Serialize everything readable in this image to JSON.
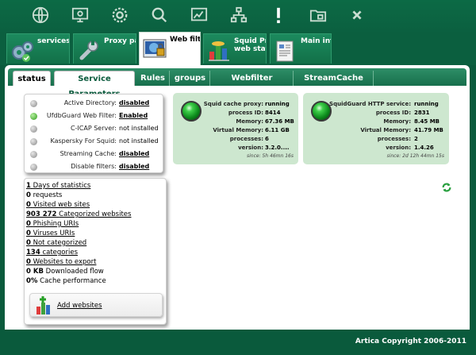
{
  "topbar": {
    "icons": [
      "globe-icon",
      "monitor-icon",
      "gear-icon",
      "search-icon",
      "chart-icon",
      "network-icon",
      "alert-icon",
      "folder-icon",
      "close-icon"
    ]
  },
  "module_tabs": [
    {
      "label": "services s",
      "icon": "gears-icon"
    },
    {
      "label": "Proxy para",
      "icon": "wrench-icon"
    },
    {
      "label": "Web filterin",
      "icon": "webfilter-icon",
      "active": true
    },
    {
      "label": "Squid Prox\nweb statis",
      "icon": "stats-icon"
    },
    {
      "label": "Main interf",
      "icon": "document-icon"
    }
  ],
  "sub_tabs": [
    {
      "label": "status",
      "active": true
    },
    {
      "label": "Service Parameters",
      "selected": true
    },
    {
      "label": "Rules"
    },
    {
      "label": "groups"
    },
    {
      "label": "Webfilter databases"
    },
    {
      "label": "StreamCache status"
    }
  ],
  "status_box": {
    "rows": [
      {
        "label": "Active Directory:",
        "value": "disabled",
        "ok": false,
        "link": true
      },
      {
        "label": "UfdbGuard Web Filter:",
        "value": "Enabled",
        "ok": true,
        "link": true
      },
      {
        "label": "C-ICAP Server:",
        "value": "not installed",
        "ok": false,
        "link": false
      },
      {
        "label": "Kaspersky For Squid:",
        "value": "not installed",
        "ok": false,
        "link": false
      },
      {
        "label": "Streaming Cache:",
        "value": "disabled",
        "ok": false,
        "link": true
      },
      {
        "label": "Disable filters:",
        "value": "disabled",
        "ok": false,
        "link": true
      }
    ]
  },
  "stats_box": {
    "rows": [
      {
        "num": "1",
        "text": "Days of statistics",
        "link": true
      },
      {
        "num": "0",
        "text": "requests",
        "link": false
      },
      {
        "num": "0",
        "text": "Visited web sites",
        "link": true
      },
      {
        "num": "903 272",
        "text": "Categorized websites",
        "link": true
      },
      {
        "num": "0",
        "text": "Phishing URIs",
        "link": true
      },
      {
        "num": "0",
        "text": "Viruses URIs",
        "link": true
      },
      {
        "num": "0",
        "text": "Not categorized",
        "link": true
      },
      {
        "num": "134",
        "text": "categories",
        "link": true
      },
      {
        "num": "0",
        "text": "Websites to export",
        "link": true
      },
      {
        "num": "0 KB",
        "text": "Downloaded flow",
        "link": false
      },
      {
        "num": "0%",
        "text": "Cache performance",
        "link": false
      }
    ],
    "add_websites_label": "Add websites"
  },
  "squid_service": {
    "rows": [
      {
        "label": "Squid cache proxy:",
        "value": "running"
      },
      {
        "label": "process ID:",
        "value": "8414"
      },
      {
        "label": "Memory:",
        "value": "67.36 MB"
      },
      {
        "label": "Virtual Memory:",
        "value": "6.11 GB"
      },
      {
        "label": "processes:",
        "value": "6"
      },
      {
        "label": "version:",
        "value": "3.2.0...."
      }
    ],
    "since": "since: 5h 46mn 16s"
  },
  "squidguard_service": {
    "rows": [
      {
        "label": "SquidGuard HTTP service:",
        "value": "running"
      },
      {
        "label": "process ID:",
        "value": "2831"
      },
      {
        "label": "Memory:",
        "value": "8.45 MB"
      },
      {
        "label": "Virtual Memory:",
        "value": "41.79 MB"
      },
      {
        "label": "processes:",
        "value": "2"
      },
      {
        "label": "version:",
        "value": "1.4.26"
      }
    ],
    "since": "since: 2d 12h 44mn 15s"
  },
  "footer": {
    "copyright": "Artica Copyright 2006-2011"
  }
}
